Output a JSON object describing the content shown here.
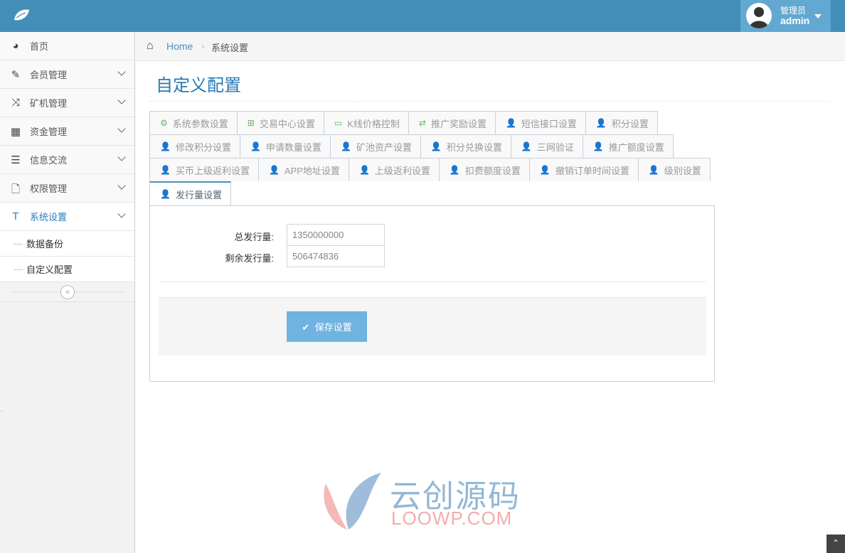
{
  "header": {
    "user_role": "管理员",
    "user_name": "admin"
  },
  "sidebar": {
    "items": [
      {
        "label": "首页",
        "icon": "dashboard-icon",
        "glyph": "◕",
        "expandable": false
      },
      {
        "label": "会员管理",
        "icon": "edit-icon",
        "glyph": "✎",
        "expandable": true
      },
      {
        "label": "矿机管理",
        "icon": "shuffle-icon",
        "glyph": "⤨",
        "expandable": true
      },
      {
        "label": "资金管理",
        "icon": "calendar-icon",
        "glyph": "▦",
        "expandable": true
      },
      {
        "label": "信息交流",
        "icon": "list-icon",
        "glyph": "☰",
        "expandable": true
      },
      {
        "label": "权限管理",
        "icon": "file-icon",
        "glyph": "🗋",
        "expandable": true
      },
      {
        "label": "系统设置",
        "icon": "text-icon",
        "glyph": "T",
        "expandable": true,
        "active": true
      }
    ],
    "subitems": [
      {
        "label": "数据备份"
      },
      {
        "label": "自定义配置"
      }
    ],
    "collapse_glyph": "«"
  },
  "breadcrumb": {
    "home": "Home",
    "current": "系统设置"
  },
  "page_title": "自定义配置",
  "tabs": {
    "rows": [
      [
        {
          "label": "系统参数设置",
          "glyph": "⚙"
        },
        {
          "label": "交易中心设置",
          "glyph": "⊞"
        },
        {
          "label": "K线价格控制",
          "glyph": "▭"
        },
        {
          "label": "推广奖励设置",
          "glyph": "⇄"
        },
        {
          "label": "短信接口设置",
          "glyph": "👤"
        },
        {
          "label": "积分设置",
          "glyph": "👤"
        }
      ],
      [
        {
          "label": "修改积分设置",
          "glyph": "👤"
        },
        {
          "label": "申请数量设置",
          "glyph": "👤"
        },
        {
          "label": "矿池资产设置",
          "glyph": "👤"
        },
        {
          "label": "积分兑换设置",
          "glyph": "👤"
        },
        {
          "label": "三网验证",
          "glyph": "👤"
        },
        {
          "label": "推广额度设置",
          "glyph": "👤"
        }
      ],
      [
        {
          "label": "买币上级返利设置",
          "glyph": "👤"
        },
        {
          "label": "APP地址设置",
          "glyph": "👤"
        },
        {
          "label": "上级返利设置",
          "glyph": "👤"
        },
        {
          "label": "扣费额度设置",
          "glyph": "👤"
        },
        {
          "label": "撤销订单时间设置",
          "glyph": "👤"
        },
        {
          "label": "级别设置",
          "glyph": "👤"
        }
      ],
      [
        {
          "label": "发行量设置",
          "glyph": "👤",
          "active": true
        }
      ]
    ]
  },
  "form": {
    "total_label": "总发行量:",
    "total_value": "1350000000",
    "remaining_label": "剩余发行量:",
    "remaining_value": "506474836",
    "save_label": "保存设置",
    "save_glyph": "✔"
  },
  "watermark": {
    "cn": "云创源码",
    "en": "LOOWP.COM"
  },
  "colors": {
    "header": "#438eb9",
    "accent": "#2b7dbc",
    "save_button": "#6fb3e0",
    "tab_icon": "#6fb36b"
  }
}
